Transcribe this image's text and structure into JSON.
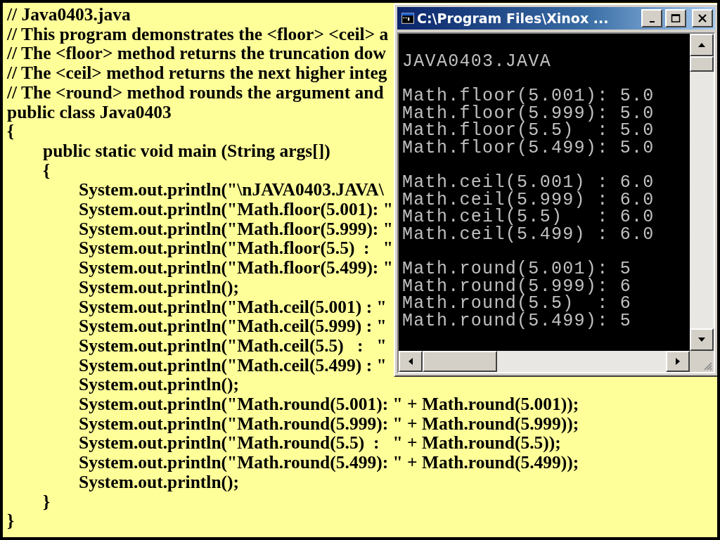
{
  "slide": {
    "code_lines": [
      {
        "text": "// Java0403.java"
      },
      {
        "text": "// This program demonstrates the <floor> <ceil> a"
      },
      {
        "text": "// The <floor> method returns the truncation dow"
      },
      {
        "text": "// The <ceil> method returns the next higher integ"
      },
      {
        "text": "// The <round> method rounds the argument and"
      },
      {
        "text": "public class Java0403"
      },
      {
        "text": "{",
        "children": [
          {
            "text": "public static void main (String args[])"
          },
          {
            "text": "{",
            "children": [
              {
                "text": "System.out.println(\"\\nJAVA0403.JAVA\\"
              },
              {
                "text": "System.out.println(\"Math.floor(5.001): \""
              },
              {
                "text": "System.out.println(\"Math.floor(5.999): \""
              },
              {
                "text": "System.out.println(\"Math.floor(5.5)  :   \""
              },
              {
                "text": "System.out.println(\"Math.floor(5.499): \""
              },
              {
                "text": "System.out.println();"
              },
              {
                "text": "System.out.println(\"Math.ceil(5.001) : \""
              },
              {
                "text": "System.out.println(\"Math.ceil(5.999) : \""
              },
              {
                "text": "System.out.println(\"Math.ceil(5.5)   :   \""
              },
              {
                "text": "System.out.println(\"Math.ceil(5.499) : \""
              },
              {
                "text": "System.out.println();"
              },
              {
                "text": "System.out.println(\"Math.round(5.001): \" + Math.round(5.001));"
              },
              {
                "text": "System.out.println(\"Math.round(5.999): \" + Math.round(5.999));"
              },
              {
                "text": "System.out.println(\"Math.round(5.5)  :   \" + Math.round(5.5));"
              },
              {
                "text": "System.out.println(\"Math.round(5.499): \" + Math.round(5.499));"
              },
              {
                "text": "System.out.println();"
              }
            ]
          },
          {
            "text": "}"
          }
        ]
      },
      {
        "text": "}"
      }
    ]
  },
  "console": {
    "title": "C:\\Program Files\\Xinox ...",
    "output_blocks": [
      [
        "JAVA0403.JAVA"
      ],
      [
        "Math.floor(5.001): 5.0",
        "Math.floor(5.999): 5.0",
        "Math.floor(5.5)  : 5.0",
        "Math.floor(5.499): 5.0"
      ],
      [
        "Math.ceil(5.001) : 6.0",
        "Math.ceil(5.999) : 6.0",
        "Math.ceil(5.5)   : 6.0",
        "Math.ceil(5.499) : 6.0"
      ],
      [
        "Math.round(5.001): 5",
        "Math.round(5.999): 6",
        "Math.round(5.5)  : 6",
        "Math.round(5.499): 5"
      ]
    ]
  }
}
